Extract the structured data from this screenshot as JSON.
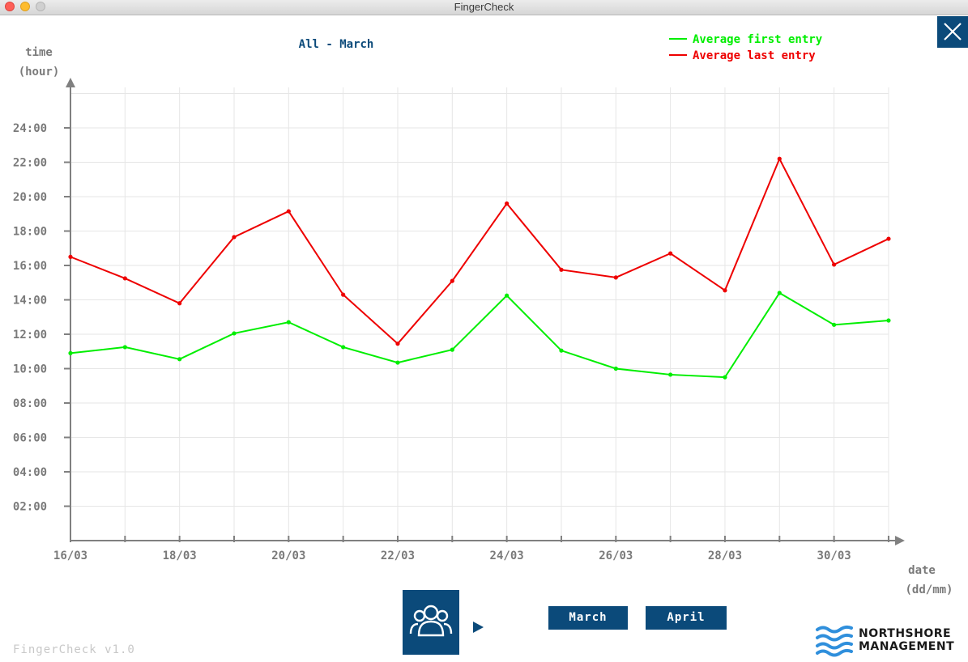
{
  "window": {
    "title": "FingerCheck"
  },
  "chart_data": {
    "type": "line",
    "title": "All - March",
    "ylabel_line1": "time",
    "ylabel_line2": "(hour)",
    "xlabel_line1": "date",
    "xlabel_line2": "(dd/mm)",
    "x": [
      "16/03",
      "17/03",
      "18/03",
      "19/03",
      "20/03",
      "21/03",
      "22/03",
      "23/03",
      "24/03",
      "25/03",
      "26/03",
      "27/03",
      "28/03",
      "29/03",
      "30/03",
      "31/03"
    ],
    "x_tick_labels": [
      "16/03",
      "18/03",
      "20/03",
      "22/03",
      "24/03",
      "26/03",
      "28/03",
      "30/03"
    ],
    "y_tick_labels": [
      "02:00",
      "04:00",
      "06:00",
      "08:00",
      "10:00",
      "12:00",
      "14:00",
      "16:00",
      "18:00",
      "20:00",
      "22:00",
      "24:00"
    ],
    "ylim": [
      0,
      26
    ],
    "grid": true,
    "legend_position": "top-right",
    "series": [
      {
        "name": "Average first entry",
        "color": "#00ee00",
        "values": [
          10.9,
          11.25,
          10.55,
          12.05,
          12.7,
          11.25,
          10.35,
          11.1,
          14.25,
          11.05,
          10.0,
          9.65,
          9.5,
          14.4,
          12.55,
          12.8
        ]
      },
      {
        "name": "Average last entry",
        "color": "#ee0000",
        "values": [
          16.5,
          15.25,
          13.8,
          17.65,
          19.15,
          14.3,
          11.45,
          15.1,
          19.6,
          15.75,
          15.3,
          16.7,
          14.55,
          22.2,
          16.05,
          17.55
        ]
      }
    ]
  },
  "controls": {
    "close_icon": "close-icon",
    "people_icon": "people-group-icon",
    "play_icon": "play-arrow-icon",
    "month_buttons": [
      "March",
      "April"
    ]
  },
  "footer": {
    "version": "FingerCheck v1.0",
    "logo_line1": "NORTHSHORE",
    "logo_line2": "MANAGEMENT"
  },
  "colors": {
    "accent": "#0b4a7a",
    "grid": "#e6e6e6",
    "axis": "#808080",
    "first_entry": "#00ee00",
    "last_entry": "#ee0000",
    "logo_waves": "#2f8fdc"
  }
}
